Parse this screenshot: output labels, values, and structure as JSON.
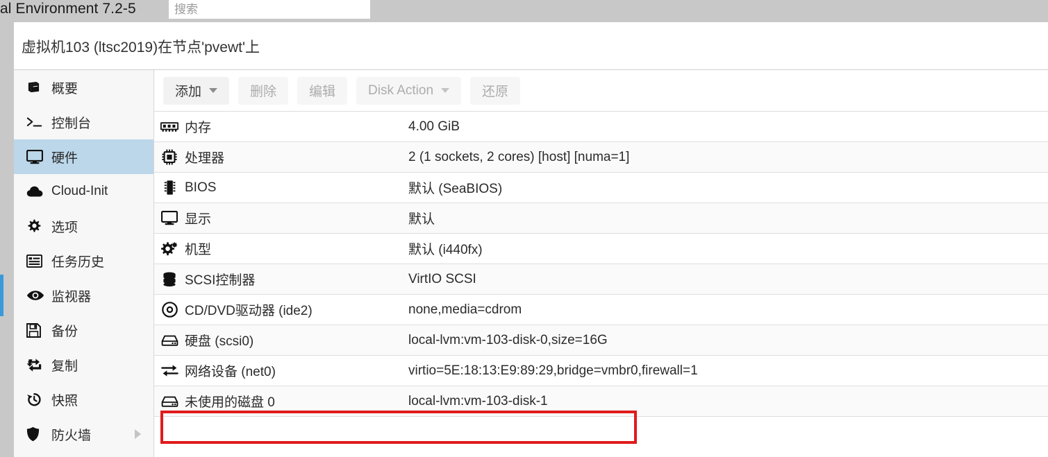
{
  "app": {
    "brand": "al Environment 7.2-5",
    "search_placeholder": "搜索",
    "page_title": "虚拟机103 (ltsc2019)在节点'pvewt'上"
  },
  "sidebar": {
    "items": [
      {
        "label": "概要",
        "icon": "book-icon",
        "selected": false,
        "has_submenu": false
      },
      {
        "label": "控制台",
        "icon": "terminal-icon",
        "selected": false,
        "has_submenu": false
      },
      {
        "label": "硬件",
        "icon": "monitor-icon",
        "selected": true,
        "has_submenu": false
      },
      {
        "label": "Cloud-Init",
        "icon": "cloud-icon",
        "selected": false,
        "has_submenu": false
      },
      {
        "label": "选项",
        "icon": "gear-icon",
        "selected": false,
        "has_submenu": false
      },
      {
        "label": "任务历史",
        "icon": "list-icon",
        "selected": false,
        "has_submenu": false
      },
      {
        "label": "监视器",
        "icon": "eye-icon",
        "selected": false,
        "has_submenu": false
      },
      {
        "label": "备份",
        "icon": "floppy-icon",
        "selected": false,
        "has_submenu": false
      },
      {
        "label": "复制",
        "icon": "replicate-icon",
        "selected": false,
        "has_submenu": false
      },
      {
        "label": "快照",
        "icon": "history-icon",
        "selected": false,
        "has_submenu": false
      },
      {
        "label": "防火墙",
        "icon": "shield-icon",
        "selected": false,
        "has_submenu": true
      }
    ]
  },
  "toolbar": {
    "buttons": [
      {
        "label": "添加",
        "disabled": false,
        "has_caret": true
      },
      {
        "label": "删除",
        "disabled": true,
        "has_caret": false
      },
      {
        "label": "编辑",
        "disabled": true,
        "has_caret": false
      },
      {
        "label": "Disk Action",
        "disabled": true,
        "has_caret": true
      },
      {
        "label": "还原",
        "disabled": true,
        "has_caret": false
      }
    ]
  },
  "hardware": {
    "rows": [
      {
        "icon": "memory-icon",
        "key": "内存",
        "value": "4.00 GiB"
      },
      {
        "icon": "cpu-icon",
        "key": "处理器",
        "value": "2 (1 sockets, 2 cores) [host] [numa=1]"
      },
      {
        "icon": "chip-icon",
        "key": "BIOS",
        "value": "默认 (SeaBIOS)"
      },
      {
        "icon": "display-icon",
        "key": "显示",
        "value": "默认"
      },
      {
        "icon": "gears-icon",
        "key": "机型",
        "value": "默认 (i440fx)"
      },
      {
        "icon": "database-icon",
        "key": "SCSI控制器",
        "value": "VirtIO SCSI"
      },
      {
        "icon": "disc-icon",
        "key": "CD/DVD驱动器 (ide2)",
        "value": "none,media=cdrom"
      },
      {
        "icon": "harddisk-icon",
        "key": "硬盘 (scsi0)",
        "value": "local-lvm:vm-103-disk-0,size=16G"
      },
      {
        "icon": "network-icon",
        "key": "网络设备 (net0)",
        "value": "virtio=5E:18:13:E9:89:29,bridge=vmbr0,firewall=1"
      },
      {
        "icon": "harddisk-icon",
        "key": "未使用的磁盘 0",
        "value": "local-lvm:vm-103-disk-1"
      }
    ]
  },
  "annotation": {
    "color": "#e01b1b",
    "target_row_key": "未使用的磁盘 0"
  },
  "colors": {
    "selected_nav": "#bcd7ea",
    "accent": "#3a9ad9",
    "annotation": "#e01b1b",
    "chrome": "#c8c8c8"
  }
}
